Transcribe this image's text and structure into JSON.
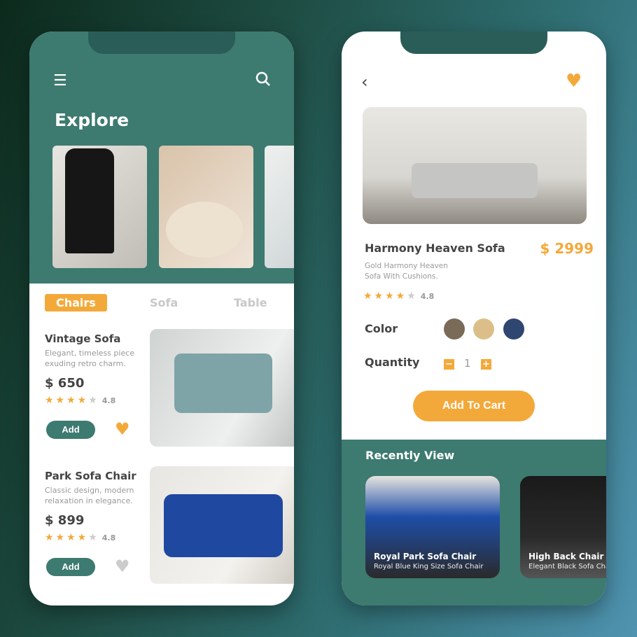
{
  "explore": {
    "title": "Explore",
    "icons": {
      "menu": "menu-icon",
      "search": "search-icon"
    },
    "tabs": [
      {
        "label": "Chairs",
        "active": true
      },
      {
        "label": "Sofa",
        "active": false
      },
      {
        "label": "Table",
        "active": false
      }
    ],
    "products": [
      {
        "name": "Vintage Sofa",
        "desc": "Elegant, timeless piece exuding retro charm.",
        "price": "$ 650",
        "rating": "4.8",
        "stars": 4,
        "add": "Add",
        "favorite": true
      },
      {
        "name": "Park Sofa Chair",
        "desc": "Classic design, modern relaxation in elegance.",
        "price": "$ 899",
        "rating": "4.8",
        "stars": 4,
        "add": "Add",
        "favorite": false
      }
    ]
  },
  "detail": {
    "name": "Harmony Heaven Sofa",
    "price": "$ 2999",
    "desc": "Gold Harmony Heaven Sofa With Cushions.",
    "rating": "4.8",
    "stars": 4,
    "color_label": "Color",
    "colors": [
      "#7a6a58",
      "#dcbf88",
      "#2e4670"
    ],
    "quantity_label": "Quantity",
    "quantity": "1",
    "add_to_cart": "Add To Cart",
    "recent_title": "Recently View",
    "recent": [
      {
        "name": "Royal Park Sofa Chair",
        "desc": "Royal Blue King Size Sofa Chair"
      },
      {
        "name": "High Back Chair",
        "desc": "Elegant Black Sofa Chair"
      }
    ]
  },
  "colors": {
    "accent": "#f3a93a",
    "primary": "#3d7a70"
  }
}
